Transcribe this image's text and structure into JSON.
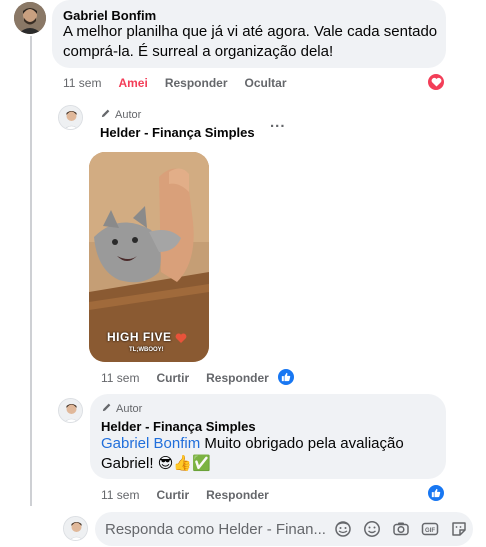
{
  "comments": [
    {
      "author": "Gabriel Bonfim",
      "text_line1": "A melhor planilha que já vi até agora. Vale cada sentado",
      "text_line2": "comprá-la. É surreal a organização dela!",
      "time": "11 sem",
      "reaction_state": "Amei",
      "reply_label": "Responder",
      "hide_label": "Ocultar",
      "reaction_icon": "heart-icon"
    },
    {
      "author_tag": "Autor",
      "author": "Helder - Finança Simples",
      "more_label": "...",
      "gif_text_main": "HIGH FIVE",
      "gif_text_sub": "TL;WBOOY!",
      "time": "11 sem",
      "like_label": "Curtir",
      "reply_label": "Responder",
      "reaction_icon": "thumbs-up-icon"
    },
    {
      "author_tag": "Autor",
      "author": "Helder - Finança Simples",
      "mention": "Gabriel Bonfim",
      "text_line1": " Muito obrigado pela avaliação",
      "text_line2": "Gabriel! 😎👍✅",
      "time": "11 sem",
      "like_label": "Curtir",
      "reply_label": "Responder",
      "reaction_icon": "thumbs-up-icon"
    }
  ],
  "reply_box": {
    "placeholder": "Responda como Helder - Finan...",
    "icons": [
      "avatar-sticker-icon",
      "emoji-icon",
      "camera-icon",
      "gif-icon",
      "sticker-icon"
    ]
  },
  "colors": {
    "love": "#f33e58",
    "like": "#1877f2",
    "mention": "#216fdb",
    "secondary_text": "#65676b",
    "bubble": "#f0f2f5"
  }
}
